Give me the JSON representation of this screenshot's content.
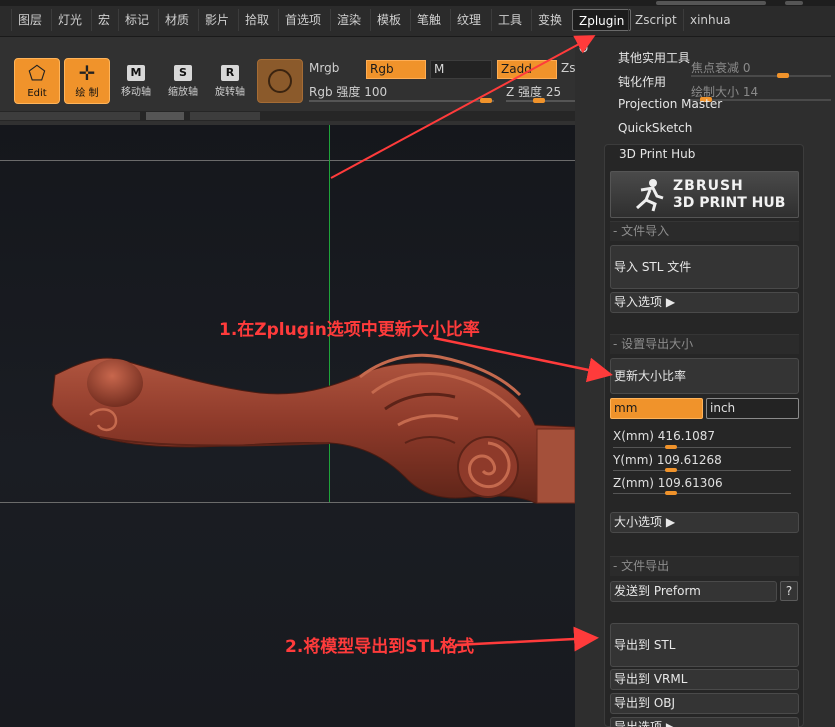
{
  "menu": {
    "items": [
      "图层",
      "灯光",
      "宏",
      "标记",
      "材质",
      "影片",
      "拾取",
      "首选项",
      "渲染",
      "模板",
      "笔触",
      "纹理",
      "工具",
      "变换",
      "Zplugin",
      "Zscript",
      "xinhua"
    ],
    "active_index": 14
  },
  "toolbar": {
    "edit_label": "Edit",
    "draw_label": "绘 制",
    "move_key": "M",
    "move_label": "移动轴",
    "scale_key": "S",
    "scale_label": "缩放轴",
    "rotate_key": "R",
    "rotate_label": "旋转轴",
    "mrgb": "Mrgb",
    "rgb": "Rgb",
    "m": "M",
    "zadd": "Zadd",
    "zsub": "Zsub",
    "rgb_intensity": "Rgb 强度 100",
    "z_intensity": "Z 强度 25"
  },
  "background_labels": {
    "focal_shift": "焦点衰减 0",
    "draw_size": "绘制大小 14"
  },
  "dropdown": {
    "items": [
      "其他实用工具",
      "钝化作用",
      "Projection Master",
      "QuickSketch"
    ]
  },
  "hub": {
    "title": "3D Print Hub",
    "logo_line1": "ZBRUSH",
    "logo_line2": "3D PRINT HUB",
    "sec_import": "- 文件导入",
    "import_stl": "导入 STL 文件",
    "import_options": "导入选项 ▶",
    "sec_size": "- 设置导出大小",
    "update_ratio": "更新大小比率",
    "unit_mm": "mm",
    "unit_inch": "inch",
    "x": "X(mm)",
    "x_value": "416.1087",
    "y": "Y(mm)",
    "y_value": "109.61268",
    "z": "Z(mm)",
    "z_value": "109.61306",
    "size_options": "大小选项 ▶",
    "sec_export": "- 文件导出",
    "send_preform": "发送到 Preform",
    "help": "?",
    "export_stl": "导出到 STL",
    "export_vrml": "导出到 VRML",
    "export_obj": "导出到 OBJ",
    "export_options": "导出选项 ▶"
  },
  "annotations": {
    "step1": "1.在Zplugin选项中更新大小比率",
    "step2": "2.将模型导出到STL格式"
  },
  "colors": {
    "accent": "#f0932b",
    "annotation": "#ff3b3b",
    "model": "#8e3a2a"
  }
}
